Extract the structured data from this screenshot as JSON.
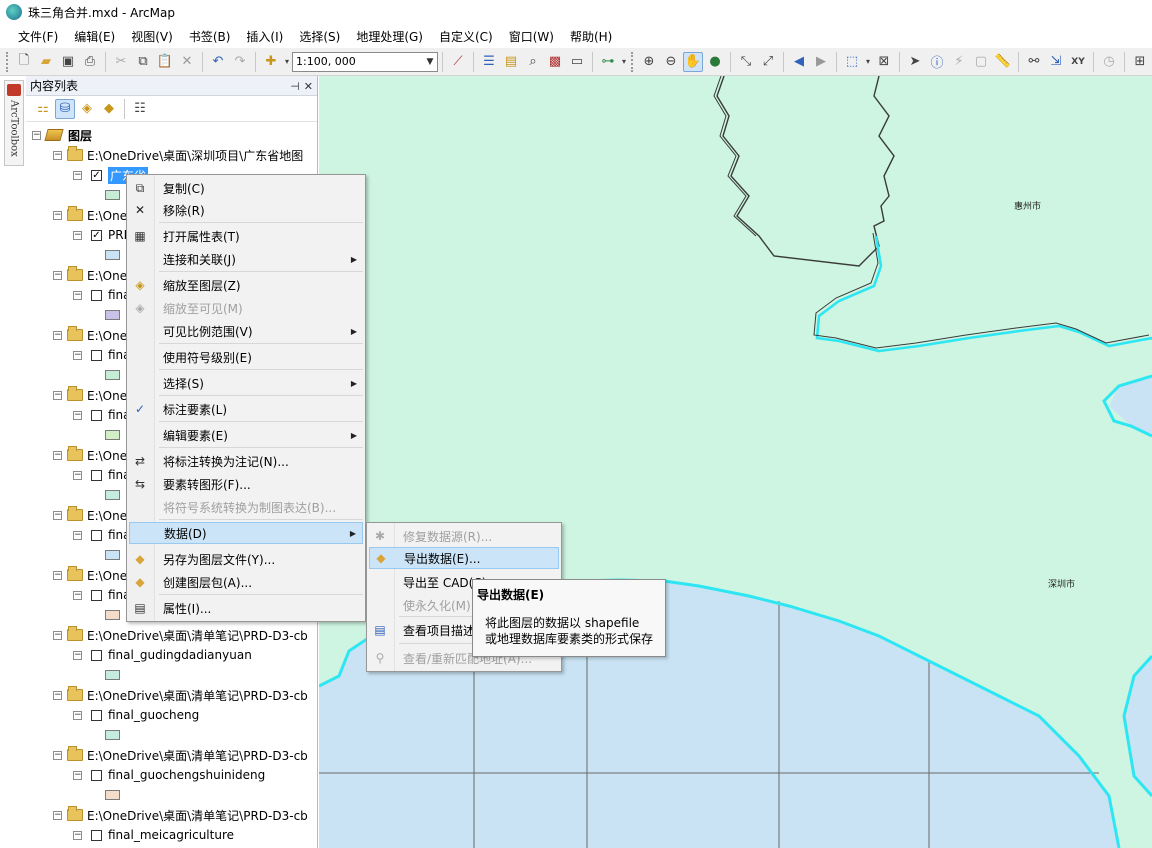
{
  "window": {
    "title": "珠三角合并.mxd - ArcMap"
  },
  "menubar": [
    "文件(F)",
    "编辑(E)",
    "视图(V)",
    "书签(B)",
    "插入(I)",
    "选择(S)",
    "地理处理(G)",
    "自定义(C)",
    "窗口(W)",
    "帮助(H)"
  ],
  "toolbar": {
    "scale": "1:100, 000"
  },
  "toolbox_strip": {
    "label": "ArcToolbox"
  },
  "toc": {
    "title": "内容列表",
    "root": "图层",
    "groups": [
      {
        "path": "E:\\OneDrive\\桌面\\深圳项目\\广东省地图",
        "layer": "广东省",
        "checked": true,
        "swatch": "#c6ecd6",
        "selected": true
      },
      {
        "path": "E:\\OneDrive\\桌面\\清单笔记\\PRD-D3-cb",
        "layer": "PRD",
        "checked": true,
        "swatch": "#c9e3f4"
      },
      {
        "path": "E:\\OneDrive\\桌面\\清单笔记\\PRD-D3-cb",
        "layer": "final",
        "checked": false,
        "swatch": "#c8c2e8"
      },
      {
        "path": "E:\\OneDrive\\桌面\\清单笔记\\PRD-D3-cb",
        "layer": "final",
        "checked": false,
        "swatch": "#c6ecd6"
      },
      {
        "path": "E:\\OneDrive\\桌面\\清单笔记\\PRD-D3-cb",
        "layer": "final",
        "checked": false,
        "swatch": "#d2efc6"
      },
      {
        "path": "E:\\OneDrive\\桌面\\清单笔记\\PRD-D3-cb",
        "layer": "final",
        "checked": false,
        "swatch": "#c6ecdf"
      },
      {
        "path": "E:\\OneDrive\\桌面\\清单笔记\\PRD-D3-cb",
        "layer": "final",
        "checked": false,
        "swatch": "#c9e3f4"
      },
      {
        "path": "E:\\OneDrive\\桌面\\清单笔记\\PRD-D3-cb",
        "layer": "final",
        "checked": false,
        "swatch": "#f3dcc9"
      },
      {
        "path": "E:\\OneDrive\\桌面\\清单笔记\\PRD-D3-cb",
        "layer": "final_gudingdadianyuan",
        "checked": false,
        "swatch": "#c6ecdf"
      },
      {
        "path": "E:\\OneDrive\\桌面\\清单笔记\\PRD-D3-cb",
        "layer": "final_guocheng",
        "checked": false,
        "swatch": "#c6ecdf"
      },
      {
        "path": "E:\\OneDrive\\桌面\\清单笔记\\PRD-D3-cb",
        "layer": "final_guochengshuinideng",
        "checked": false,
        "swatch": "#f3dcc9"
      },
      {
        "path": "E:\\OneDrive\\桌面\\清单笔记\\PRD-D3-cb",
        "layer": "final_meicagriculture",
        "checked": false,
        "swatch": "#c6ecdf"
      }
    ]
  },
  "context_menu": {
    "items": [
      {
        "label": "复制(C)",
        "icon": "copy-icon"
      },
      {
        "label": "移除(R)",
        "icon": "remove-x-icon"
      },
      {
        "label": "打开属性表(T)",
        "icon": "table-icon"
      },
      {
        "label": "连接和关联(J)",
        "submenu": true
      },
      {
        "label": "缩放至图层(Z)",
        "icon": "zoom-layer-icon"
      },
      {
        "label": "缩放至可见(M)",
        "icon": "zoom-visible-icon",
        "disabled": true
      },
      {
        "label": "可见比例范围(V)",
        "submenu": true
      },
      {
        "label": "使用符号级别(E)"
      },
      {
        "label": "选择(S)",
        "submenu": true
      },
      {
        "label": "标注要素(L)",
        "icon": "checkmark-icon"
      },
      {
        "label": "编辑要素(E)",
        "submenu": true
      },
      {
        "label": "将标注转换为注记(N)...",
        "icon": "convert-labels-icon"
      },
      {
        "label": "要素转图形(F)...",
        "icon": "features-to-graphics-icon"
      },
      {
        "label": "将符号系统转换为制图表达(B)...",
        "disabled": true
      },
      {
        "label": "数据(D)",
        "submenu": true,
        "highlighted": true
      },
      {
        "label": "另存为图层文件(Y)...",
        "icon": "layer-file-icon"
      },
      {
        "label": "创建图层包(A)...",
        "icon": "layer-package-icon"
      },
      {
        "label": "属性(I)...",
        "icon": "properties-icon"
      }
    ]
  },
  "data_submenu": {
    "items": [
      {
        "label": "修复数据源(R)...",
        "icon": "repair-source-icon",
        "disabled": true
      },
      {
        "label": "导出数据(E)...",
        "icon": "export-data-icon",
        "highlighted": true
      },
      {
        "label": "导出至 CAD(C)..."
      },
      {
        "label": "使永久化(M)",
        "disabled": true
      },
      {
        "label": "查看项目描述(V)...",
        "icon": "item-description-icon"
      },
      {
        "label": "查看/重新匹配地址(A)...",
        "icon": "rematch-address-icon",
        "disabled": true
      }
    ]
  },
  "tooltip": {
    "title": "导出数据(E)",
    "line1": "将此图层的数据以 shapefile",
    "line2": "或地理数据库要素类的形式保存"
  },
  "map": {
    "labels": [
      "惠州市",
      "深圳市"
    ],
    "land_color": "#cdf5e1",
    "water_color": "#c9e3f4",
    "boundary_color": "#2ee6f2"
  }
}
